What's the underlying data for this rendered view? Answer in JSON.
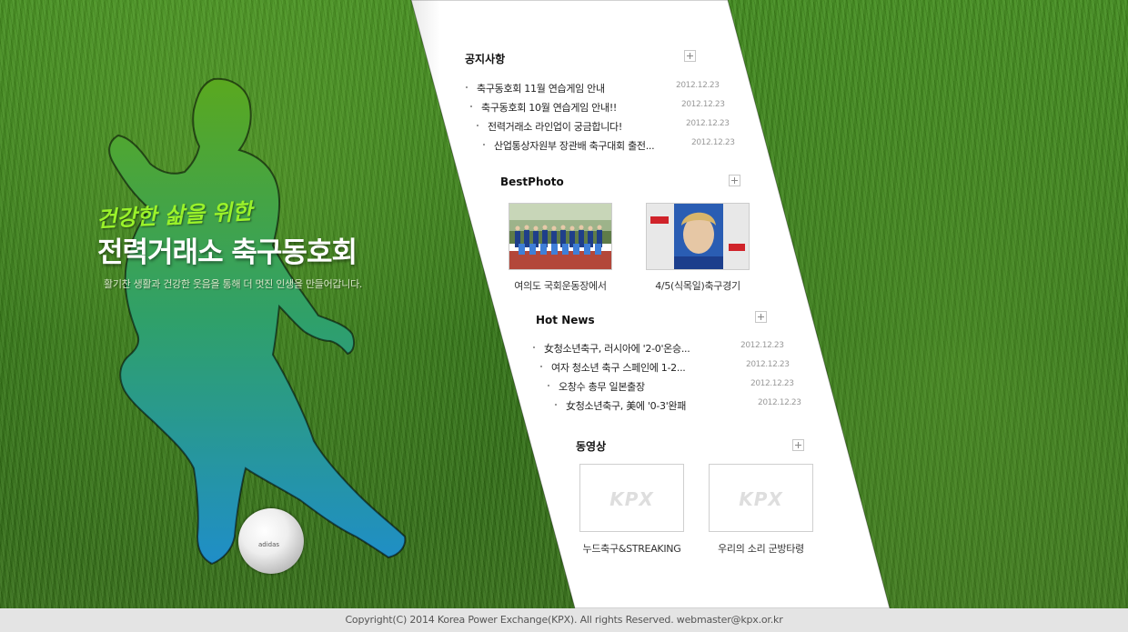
{
  "hero": {
    "script_line": "건강한 삶을 위한",
    "title": "전력거래소 축구동호회",
    "subtitle": "활기찬 생활과 건강한 웃음을 통해 더 멋진 인생을 만들어갑니다."
  },
  "notice": {
    "title": "공지사항",
    "items": [
      {
        "text": "축구동호회 11월 연습게임 안내",
        "date": "2012.12.23"
      },
      {
        "text": "축구동호회 10월 연습게임 안내!!",
        "date": "2012.12.23"
      },
      {
        "text": "전력거래소 라인업이 궁금합니다!",
        "date": "2012.12.23"
      },
      {
        "text": "산업통상자원부 장관배 축구대회 출전...",
        "date": "2012.12.23"
      }
    ]
  },
  "best_photo": {
    "title": "BestPhoto",
    "items": [
      {
        "caption": "여의도 국회운동장에서"
      },
      {
        "caption": "4/5(식목일)축구경기"
      }
    ]
  },
  "hot_news": {
    "title": "Hot News",
    "items": [
      {
        "text": "女청소년축구, 러시아에 '2-0'온승...",
        "date": "2012.12.23"
      },
      {
        "text": "여자 청소년 축구 스페인에 1-2...",
        "date": "2012.12.23"
      },
      {
        "text": "오창수 총무 일본출장",
        "date": "2012.12.23"
      },
      {
        "text": "女청소년축구, 美에 '0-3'완패",
        "date": "2012.12.23"
      }
    ]
  },
  "video": {
    "title": "동영상",
    "items": [
      {
        "caption": "누드축구&STREAKING",
        "logo": "KPX"
      },
      {
        "caption": "우리의 소리 군방타령",
        "logo": "KPX"
      }
    ]
  },
  "footer": {
    "text": "Copyright(C) 2014 Korea  Power Exchange(KPX). All rights Reserved. webmaster@kpx.or.kr"
  },
  "colors": {
    "grass": "#2f6d14",
    "band": "#ffffff",
    "player_top": "#5aa81f",
    "player_bottom": "#1f8ec8",
    "script_green": "#9af22a",
    "footer_bg": "#e4e4e4"
  }
}
